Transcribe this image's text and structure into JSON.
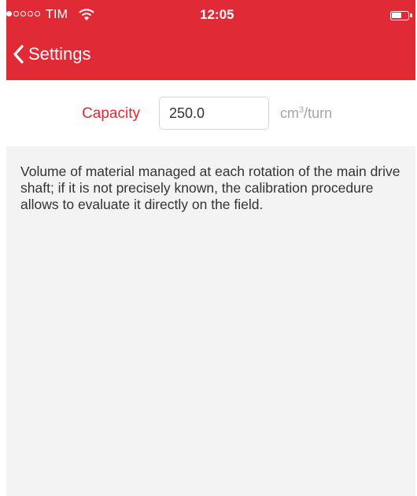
{
  "status_bar": {
    "carrier": "TIM",
    "time": "12:05",
    "signal_bars_filled": 1,
    "signal_bars_total": 5,
    "wifi_icon": "wifi-icon",
    "battery_icon": "battery-icon"
  },
  "nav": {
    "back_label": "Settings",
    "back_icon": "chevron-left-icon",
    "accent_color": "#e02b36"
  },
  "capacity": {
    "label": "Capacity",
    "value": "250.0",
    "unit_prefix": "cm",
    "unit_sup": "3",
    "unit_suffix": "/turn"
  },
  "description": {
    "text": "Volume of material managed at each rotation of the main drive shaft; if it is not precisely known, the calibration procedure allows to evaluate it directly on the field."
  }
}
